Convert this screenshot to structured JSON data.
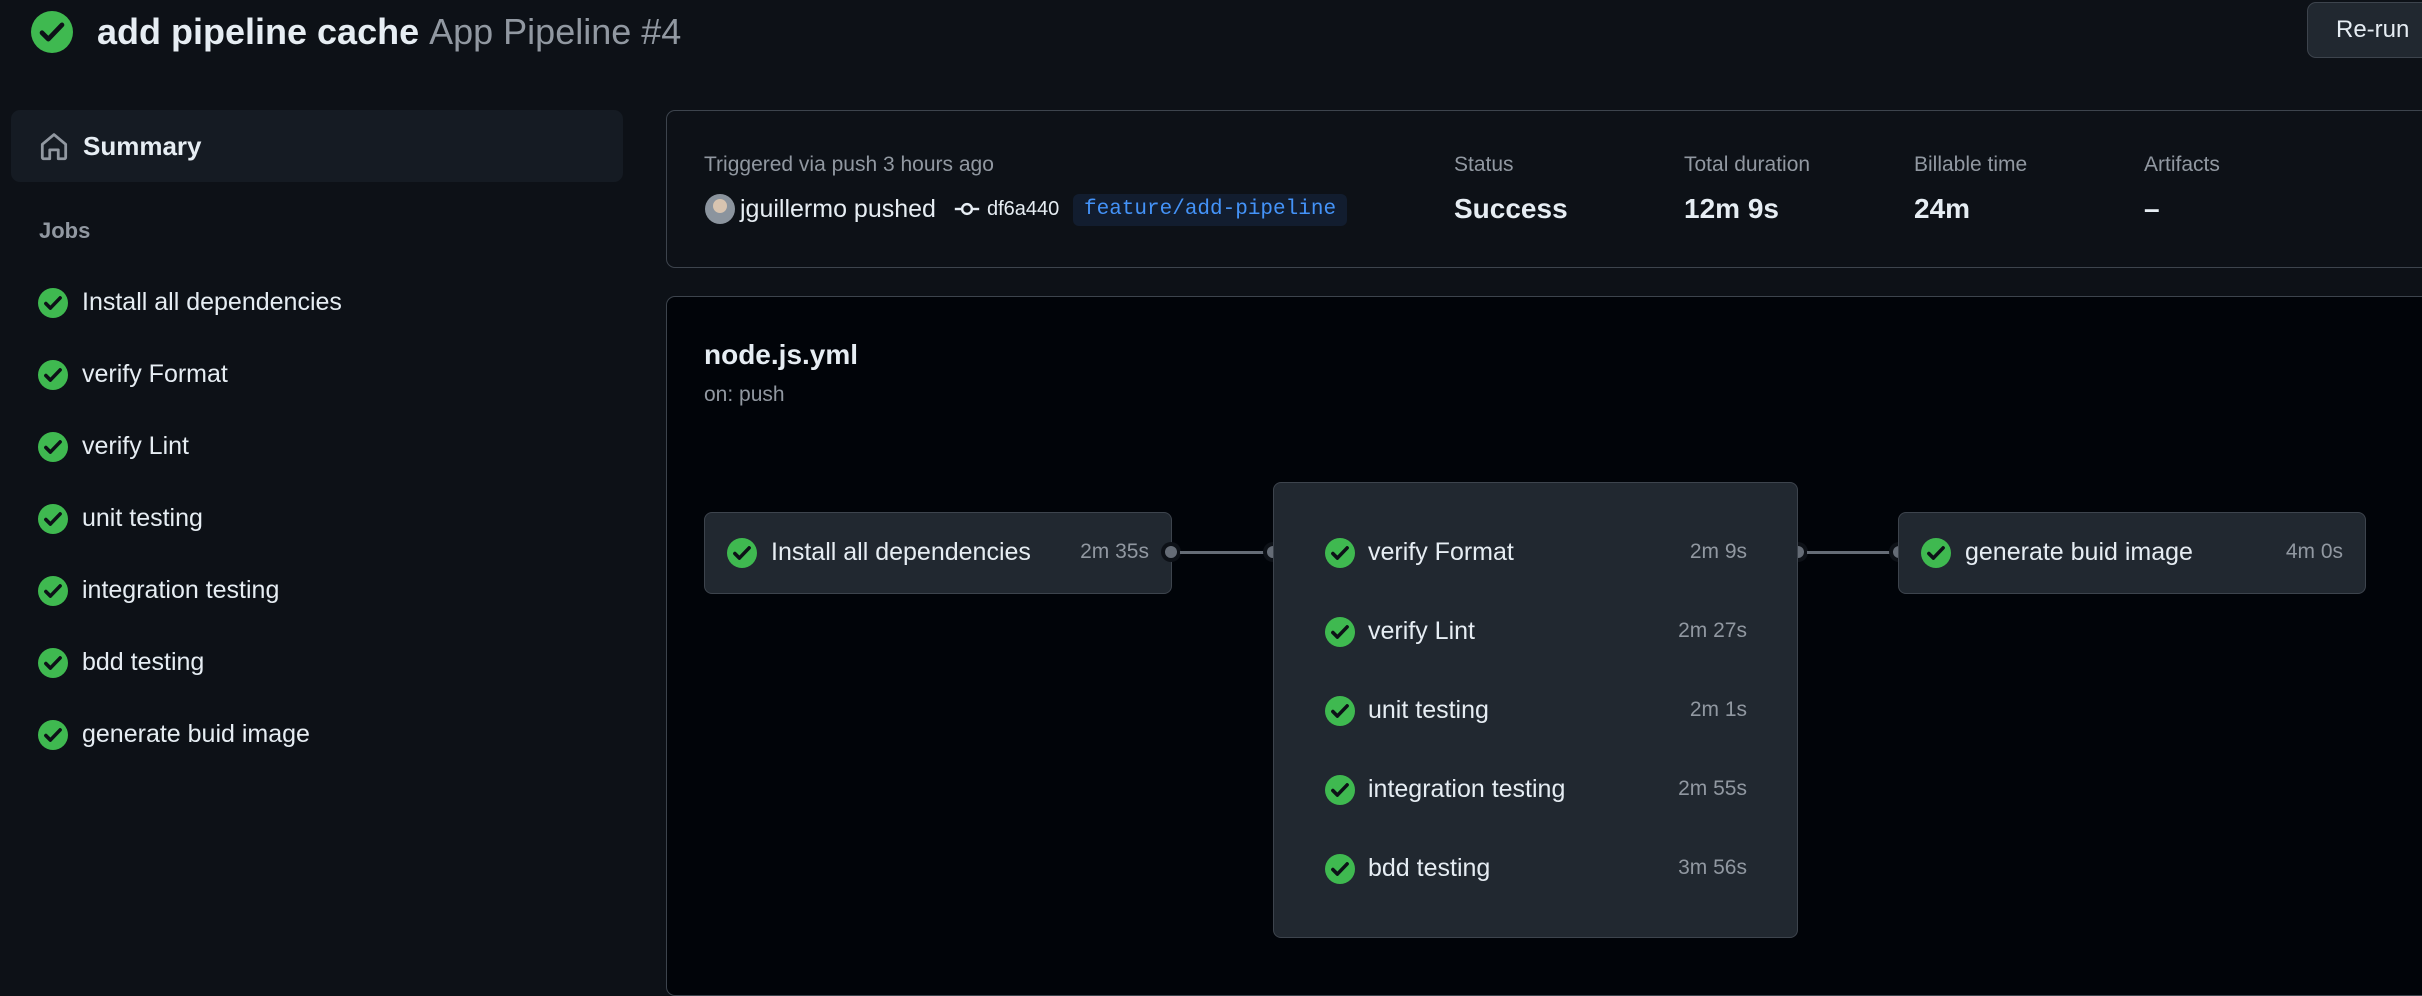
{
  "header": {
    "title": "add pipeline cache",
    "subtitle": "App Pipeline #4",
    "rerun_label": "Re-run"
  },
  "sidebar": {
    "summary_label": "Summary",
    "jobs_heading": "Jobs",
    "jobs": [
      {
        "label": "Install all dependencies"
      },
      {
        "label": "verify Format"
      },
      {
        "label": "verify Lint"
      },
      {
        "label": "unit testing"
      },
      {
        "label": "integration testing"
      },
      {
        "label": "bdd testing"
      },
      {
        "label": "generate buid image"
      }
    ]
  },
  "summary": {
    "triggered": "Triggered via push 3 hours ago",
    "actor": "jguillermo pushed",
    "commit": "df6a440",
    "branch": "feature/add-pipeline",
    "stats": [
      {
        "label": "Status",
        "value": "Success"
      },
      {
        "label": "Total duration",
        "value": "12m 9s"
      },
      {
        "label": "Billable time",
        "value": "24m"
      },
      {
        "label": "Artifacts",
        "value": "–"
      }
    ]
  },
  "workflow": {
    "name": "node.js.yml",
    "trigger": "on: push",
    "first_job": {
      "name": "Install all dependencies",
      "duration": "2m 35s"
    },
    "group_jobs": [
      {
        "name": "verify Format",
        "duration": "2m 9s"
      },
      {
        "name": "verify Lint",
        "duration": "2m 27s"
      },
      {
        "name": "unit testing",
        "duration": "2m 1s"
      },
      {
        "name": "integration testing",
        "duration": "2m 55s"
      },
      {
        "name": "bdd testing",
        "duration": "3m 56s"
      }
    ],
    "last_job": {
      "name": "generate buid image",
      "duration": "4m 0s"
    }
  },
  "colors": {
    "success": "#3fb950",
    "background": "#0d1117",
    "link": "#4493f8"
  },
  "icons": {
    "status": "check-circle-fill-icon",
    "summary": "home-icon",
    "commit": "git-commit-icon"
  }
}
